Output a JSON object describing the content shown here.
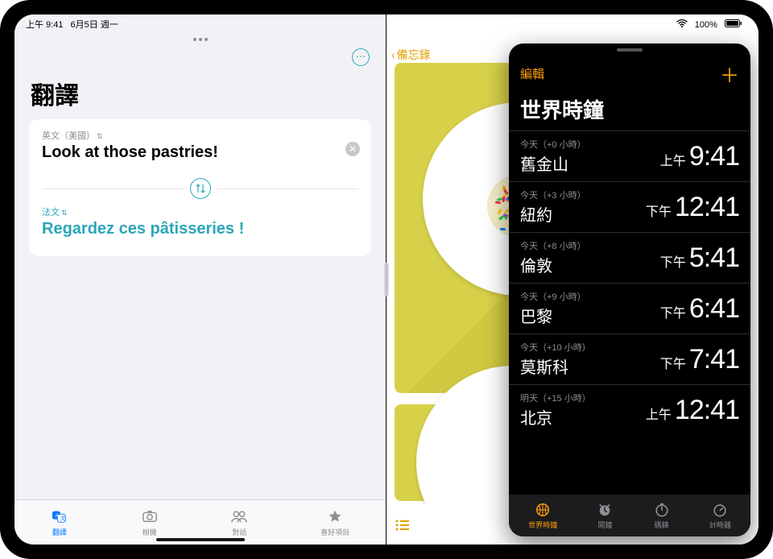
{
  "statusbar": {
    "time": "上午 9:41",
    "date": "6月5日 週一",
    "battery_pct": "100%"
  },
  "translate": {
    "title": "翻譯",
    "more_icon_label": "...",
    "source_lang": "英文（美國）",
    "source_text": "Look at those pastries!",
    "target_lang": "法文",
    "target_text": "Regardez ces pâtisseries !",
    "tabs": {
      "translate": "翻譯",
      "camera": "相機",
      "conversation": "對話",
      "favorites": "喜好項目"
    }
  },
  "notes": {
    "back_label": "備忘錄"
  },
  "clock": {
    "edit": "編輯",
    "title": "世界時鐘",
    "entries": [
      {
        "meta": "今天（+0 小時）",
        "city": "舊金山",
        "ampm": "上午",
        "time": "9:41"
      },
      {
        "meta": "今天（+3 小時）",
        "city": "紐約",
        "ampm": "下午",
        "time": "12:41"
      },
      {
        "meta": "今天（+8 小時）",
        "city": "倫敦",
        "ampm": "下午",
        "time": "5:41"
      },
      {
        "meta": "今天（+9 小時）",
        "city": "巴黎",
        "ampm": "下午",
        "time": "6:41"
      },
      {
        "meta": "今天（+10 小時）",
        "city": "莫斯科",
        "ampm": "下午",
        "time": "7:41"
      },
      {
        "meta": "明天（+15 小時）",
        "city": "北京",
        "ampm": "上午",
        "time": "12:41"
      }
    ],
    "tabs": {
      "world_clock": "世界時鐘",
      "alarm": "鬧鐘",
      "stopwatch": "碼錶",
      "timer": "計時器"
    }
  }
}
